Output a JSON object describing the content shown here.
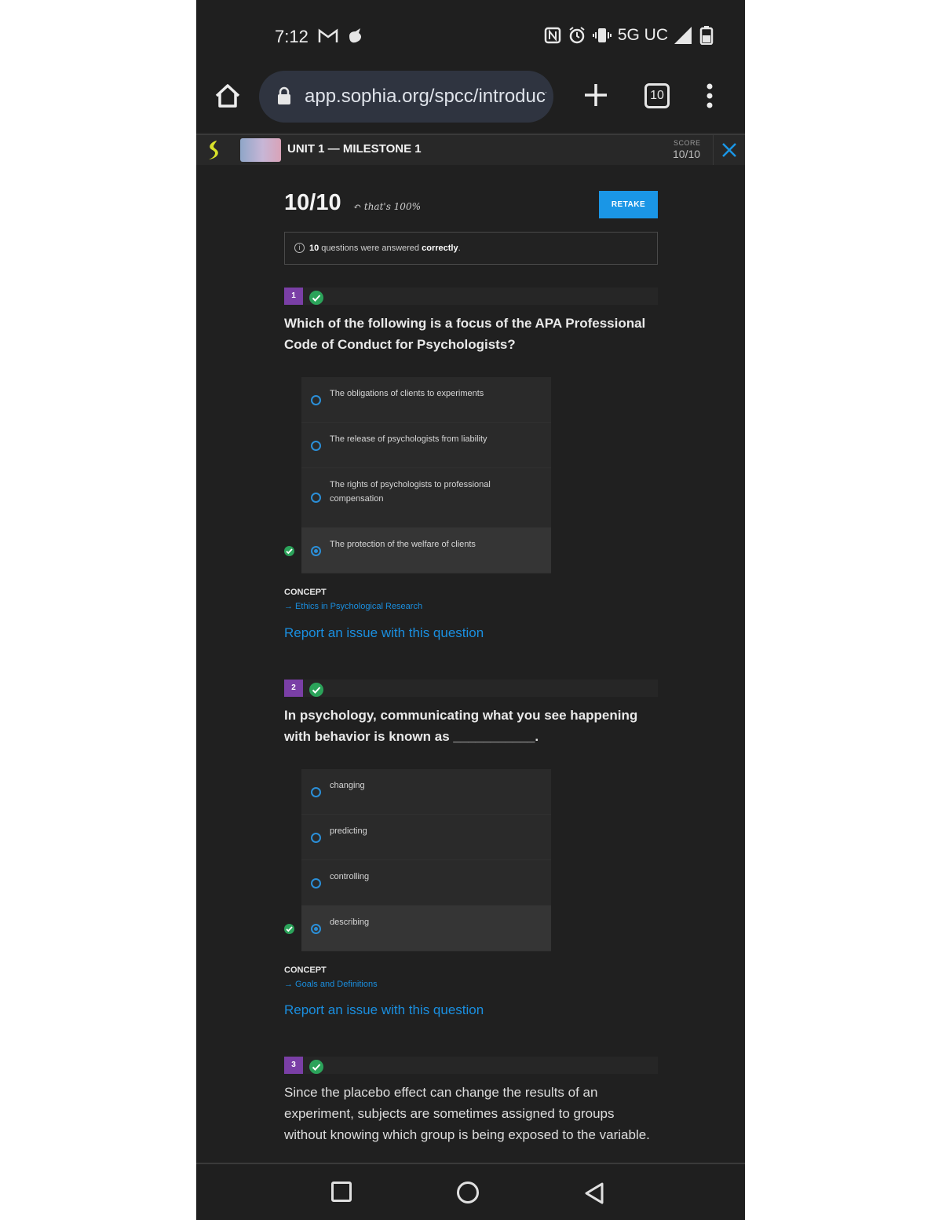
{
  "status_bar": {
    "time": "7:12",
    "network": "5G UC",
    "icons": [
      "gmail-icon",
      "app-notification-icon",
      "nfc-icon",
      "alarm-icon",
      "vibrate-icon",
      "signal-icon",
      "battery-icon"
    ]
  },
  "browser": {
    "url": "app.sophia.org/spcc/introducti",
    "tab_count": "10"
  },
  "app_header": {
    "unit_title": "UNIT 1 — MILESTONE 1",
    "score_label": "SCORE",
    "score_value": "10/10"
  },
  "results": {
    "score": "10/10",
    "note": "that's 100%",
    "retake_label": "RETAKE",
    "summary_count": "10",
    "summary_middle": " questions were answered ",
    "summary_strong": "correctly",
    "summary_end": "."
  },
  "questions": [
    {
      "number": "1",
      "text": "Which of the following is a focus of the APA Professional Code of Conduct for Psychologists?",
      "options": [
        "The obligations of clients to experiments",
        "The release of psychologists from liability",
        "The rights of psychologists to professional compensation",
        "The protection of the welfare of clients"
      ],
      "selected_index": 3,
      "concept_label": "CONCEPT",
      "concept_link": "→ Ethics in Psychological Research",
      "report_link": "Report an issue with this question"
    },
    {
      "number": "2",
      "text": "In psychology, communicating what you see happening with behavior is known as ___________.",
      "options": [
        "changing",
        "predicting",
        "controlling",
        "describing"
      ],
      "selected_index": 3,
      "concept_label": "CONCEPT",
      "concept_link": "→ Goals and Definitions",
      "report_link": "Report an issue with this question"
    },
    {
      "number": "3",
      "text": "Since the placebo effect can change the results of an experiment, subjects are sometimes assigned to groups without knowing which group is being exposed to the variable."
    }
  ],
  "colors": {
    "accent_blue": "#1a96e6",
    "correct_green": "#2ba35a",
    "question_badge": "#7a3fa6",
    "background": "#202020"
  }
}
